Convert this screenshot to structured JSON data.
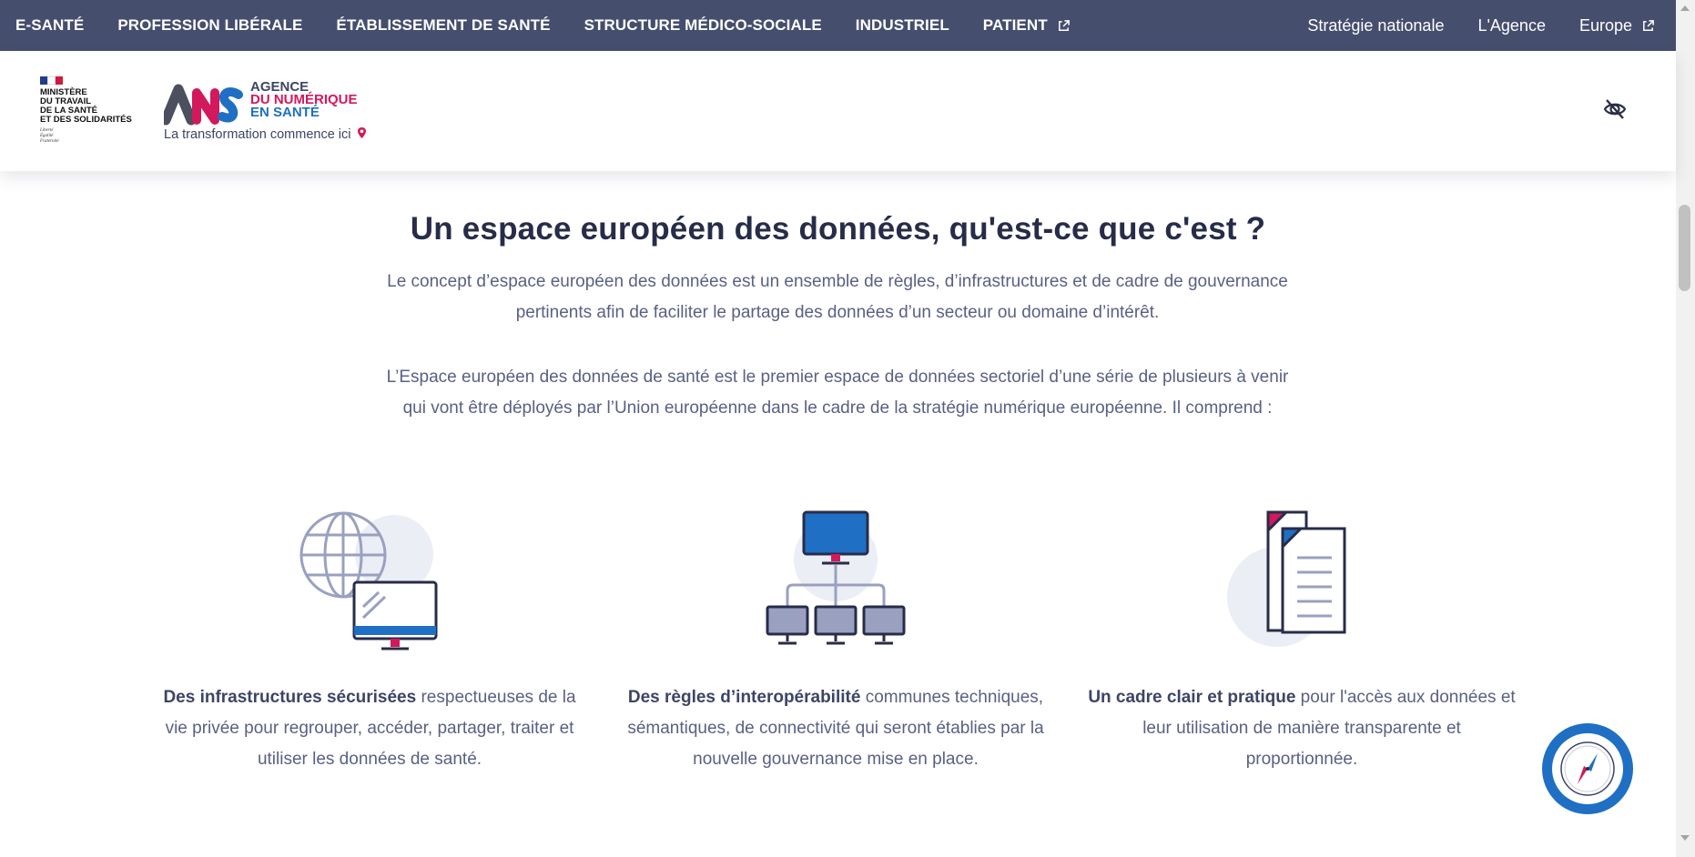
{
  "topnav": {
    "left_items": [
      {
        "label": "E-SANTÉ",
        "external": false
      },
      {
        "label": "PROFESSION LIBÉRALE",
        "external": false
      },
      {
        "label": "ÉTABLISSEMENT DE SANTÉ",
        "external": false
      },
      {
        "label": "STRUCTURE MÉDICO-SOCIALE",
        "external": false
      },
      {
        "label": "INDUSTRIEL",
        "external": false
      },
      {
        "label": "PATIENT",
        "external": true
      }
    ],
    "right_items": [
      {
        "label": "Stratégie nationale",
        "external": false
      },
      {
        "label": "L'Agence",
        "external": false
      },
      {
        "label": "Europe",
        "external": true
      }
    ]
  },
  "header": {
    "ministere": {
      "name": "MINISTÈRE\nDU TRAVAIL\nDE LA SANTÉ\nET DES SOLIDARITÉS",
      "motto": "Liberté\nÉgalité\nFraternité"
    },
    "ans": {
      "line1": "AGENCE",
      "line2": "DU NUMÉRIQUE",
      "line3": "EN SANTÉ",
      "tagline": "La transformation commence ici"
    }
  },
  "main": {
    "title": "Un espace européen des données, qu'est-ce que c'est ?",
    "paragraph1": "Le concept d’espace européen des données est un ensemble de règles, d’infrastructures et de cadre de gouvernance pertinents afin de faciliter le partage des données d’un secteur ou domaine d’intérêt.",
    "paragraph2": "L’Espace européen des données de santé est le premier espace de données sectoriel d’une série de plusieurs à venir qui vont être déployés par l’Union européenne dans le cadre de la stratégie numérique européenne. Il comprend :",
    "features": [
      {
        "bold": "Des infrastructures sécurisées",
        "text": " respectueuses de la vie privée pour regrouper, accéder, partager, traiter et utiliser les données de santé.",
        "icon": "globe-monitor-icon"
      },
      {
        "bold": "Des règles d’interopérabilité",
        "text": " communes techniques, sémantiques, de connectivité qui seront établies par la nouvelle gouvernance mise en place.",
        "icon": "network-icon"
      },
      {
        "bold": "Un cadre clair et pratique",
        "text": " pour l'accès aux données et leur utilisation de manière  transparente et proportionnée.",
        "icon": "documents-icon"
      }
    ]
  },
  "colors": {
    "nav_bg": "#464e6e",
    "title": "#272c49",
    "body_text": "#5a6084",
    "accent_blue": "#1f6fc4",
    "accent_red": "#d2195b",
    "icon_lavender": "#8f96b8"
  }
}
